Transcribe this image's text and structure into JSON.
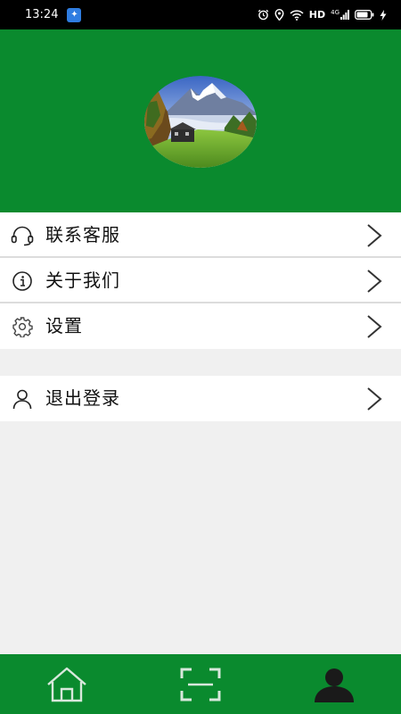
{
  "status_bar": {
    "time": "13:24",
    "app_icon": "sparkle-app-icon",
    "indicators": [
      "alarm-icon",
      "location-icon",
      "wifi-icon",
      "HD",
      "signal-icon",
      "battery-icon",
      "charging-icon"
    ],
    "hd_label": "HD",
    "network_label": "4G"
  },
  "header": {
    "background_color": "#0a8a2e",
    "avatar": "mountain-landscape-avatar"
  },
  "menu": {
    "group1": [
      {
        "label": "联系客服",
        "icon": "headset-icon"
      },
      {
        "label": "关于我们",
        "icon": "info-icon"
      },
      {
        "label": "设置",
        "icon": "gear-icon"
      }
    ],
    "group2": [
      {
        "label": "退出登录",
        "icon": "user-icon"
      }
    ]
  },
  "bottom_nav": {
    "tabs": [
      {
        "icon": "home-icon",
        "active": false
      },
      {
        "icon": "scan-icon",
        "active": false
      },
      {
        "icon": "profile-icon",
        "active": true
      }
    ],
    "colors": {
      "background": "#0a8a2e",
      "inactive": "#d8e8dc",
      "active": "#1a1a1a"
    }
  }
}
